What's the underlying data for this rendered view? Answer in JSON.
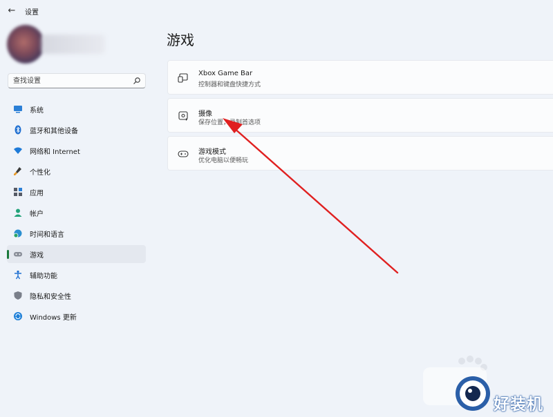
{
  "window": {
    "title": "设置",
    "back_icon": "arrow-left-icon"
  },
  "search": {
    "placeholder": "查找设置",
    "icon": "search-icon"
  },
  "sidebar": {
    "items": [
      {
        "label": "系统",
        "icon": "monitor-icon",
        "active": false
      },
      {
        "label": "蓝牙和其他设备",
        "icon": "bluetooth-icon",
        "active": false
      },
      {
        "label": "网络和 Internet",
        "icon": "wifi-icon",
        "active": false
      },
      {
        "label": "个性化",
        "icon": "brush-icon",
        "active": false
      },
      {
        "label": "应用",
        "icon": "apps-icon",
        "active": false
      },
      {
        "label": "帐户",
        "icon": "person-icon",
        "active": false
      },
      {
        "label": "时间和语言",
        "icon": "globe-clock-icon",
        "active": false
      },
      {
        "label": "游戏",
        "icon": "gamepad-icon",
        "active": true
      },
      {
        "label": "辅助功能",
        "icon": "accessibility-icon",
        "active": false
      },
      {
        "label": "隐私和安全性",
        "icon": "shield-icon",
        "active": false
      },
      {
        "label": "Windows 更新",
        "icon": "update-icon",
        "active": false
      }
    ]
  },
  "main": {
    "title": "游戏",
    "cards": [
      {
        "title": "Xbox Game Bar",
        "description": "控制器和键盘快捷方式",
        "icon": "game-bar-icon"
      },
      {
        "title": "摄像",
        "description": "保存位置，录制首选项",
        "icon": "capture-icon"
      },
      {
        "title": "游戏模式",
        "description": "优化电脑以便畅玩",
        "icon": "controller-icon"
      }
    ]
  },
  "watermark": {
    "text": "好装机"
  },
  "colors": {
    "background": "#eff3f9",
    "active_indicator": "#1a7a3c",
    "annotation_arrow": "#e02020"
  }
}
